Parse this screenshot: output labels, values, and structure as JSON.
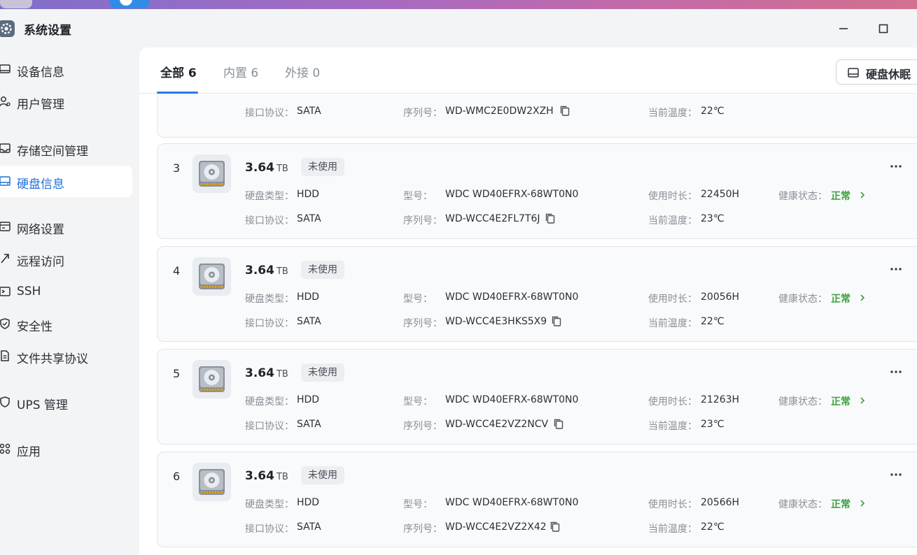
{
  "window": {
    "title": "系统设置"
  },
  "sidebar": {
    "items": [
      {
        "label": "设备信息",
        "icon": "device-icon"
      },
      {
        "label": "用户管理",
        "icon": "users-icon"
      },
      {
        "label": "存储空间管理",
        "icon": "storage-icon"
      },
      {
        "label": "硬盘信息",
        "icon": "hard-disk-icon",
        "active": true
      },
      {
        "label": "网络设置",
        "icon": "network-icon"
      },
      {
        "label": "远程访问",
        "icon": "remote-access-icon"
      },
      {
        "label": "SSH",
        "icon": "terminal-icon"
      },
      {
        "label": "安全性",
        "icon": "shield-check-icon"
      },
      {
        "label": "文件共享协议",
        "icon": "file-share-icon"
      },
      {
        "label": "UPS 管理",
        "icon": "shield-icon"
      },
      {
        "label": "应用",
        "icon": "apps-icon"
      }
    ]
  },
  "tabs": [
    {
      "label": "全部 6",
      "active": true
    },
    {
      "label": "内置 6"
    },
    {
      "label": "外接 0"
    }
  ],
  "toolbar": {
    "sleep_label": "硬盘休眠"
  },
  "labels": {
    "type": "硬盘类型：",
    "model": "型号：",
    "usage": "使用时长：",
    "health": "健康状态：",
    "interface": "接口协议：",
    "serial": "序列号：",
    "temp": "当前温度："
  },
  "partial_disk": {
    "interface": "SATA",
    "serial": "WD-WMC2E0DW2XZH",
    "temp": "22℃"
  },
  "disks": [
    {
      "index": "3",
      "size": "3.64",
      "unit": "TB",
      "status": "未使用",
      "type": "HDD",
      "model": "WDC WD40EFRX-68WT0N0",
      "usage": "22450H",
      "health": "正常",
      "interface": "SATA",
      "serial": "WD-WCC4E2FL7T6J",
      "temp": "23℃"
    },
    {
      "index": "4",
      "size": "3.64",
      "unit": "TB",
      "status": "未使用",
      "type": "HDD",
      "model": "WDC WD40EFRX-68WT0N0",
      "usage": "20056H",
      "health": "正常",
      "interface": "SATA",
      "serial": "WD-WCC4E3HKS5X9",
      "temp": "22℃"
    },
    {
      "index": "5",
      "size": "3.64",
      "unit": "TB",
      "status": "未使用",
      "type": "HDD",
      "model": "WDC WD40EFRX-68WT0N0",
      "usage": "21263H",
      "health": "正常",
      "interface": "SATA",
      "serial": "WD-WCC4E2VZ2NCV",
      "temp": "23℃"
    },
    {
      "index": "6",
      "size": "3.64",
      "unit": "TB",
      "status": "未使用",
      "type": "HDD",
      "model": "WDC WD40EFRX-68WT0N0",
      "usage": "20566H",
      "health": "正常",
      "interface": "SATA",
      "serial": "WD-WCC4E2VZ2X42",
      "temp": "22℃"
    }
  ],
  "colors": {
    "accent": "#2b78e4",
    "health_ok": "#3aa23a"
  }
}
